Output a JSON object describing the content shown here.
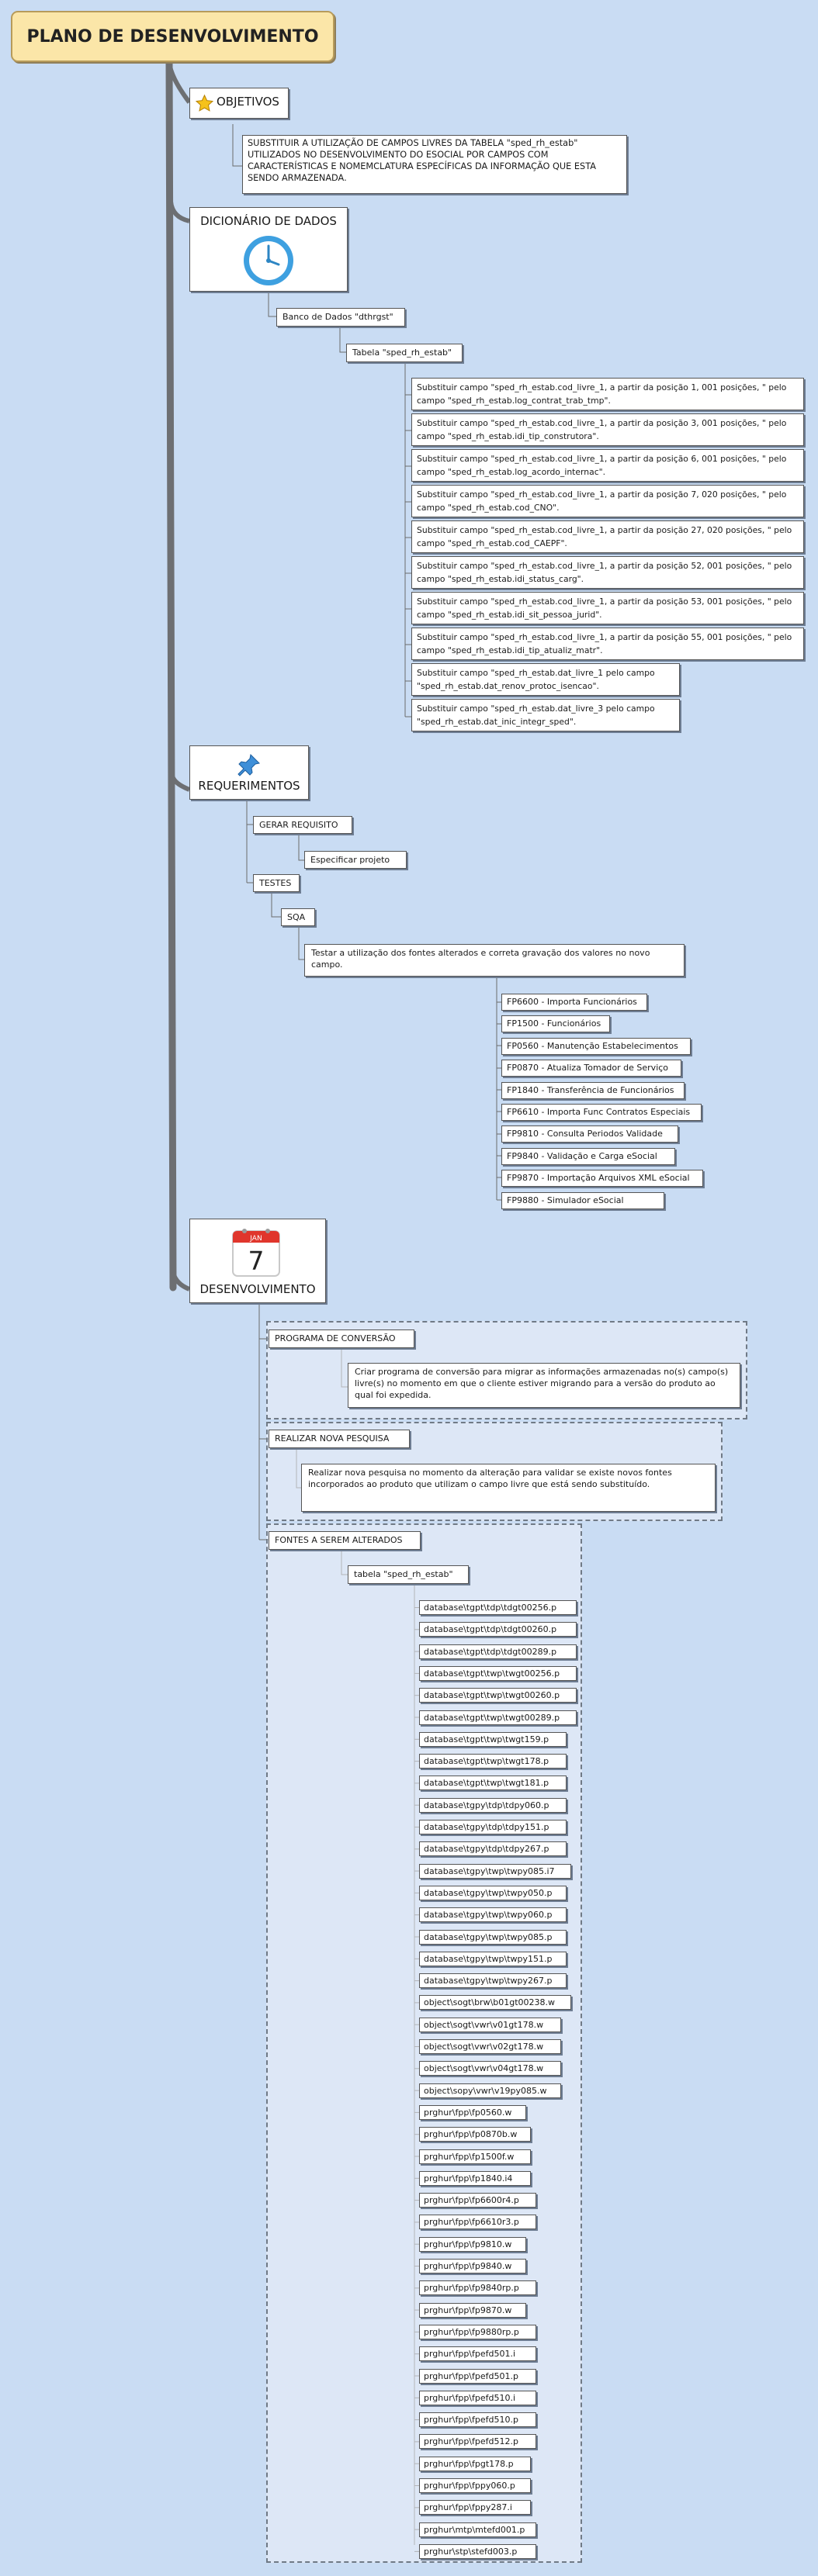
{
  "root": {
    "title": "PLANO DE DESENVOLVIMENTO"
  },
  "objetivos": {
    "label": "OBJETIVOS",
    "icon": "star-icon",
    "text": "SUBSTITUIR A UTILIZAÇÃO DE CAMPOS LIVRES DA TABELA \"sped_rh_estab\" UTILIZADOS NO DESENVOLVIMENTO DO ESOCIAL POR CAMPOS COM CARACTERÍSTICAS E NOMEMCLATURA ESPECÍFICAS DA INFORMAÇÃO QUE ESTA SENDO ARMAZENADA."
  },
  "dicionario": {
    "label": "DICIONÁRIO DE DADOS",
    "icon": "clock-icon",
    "banco": "Banco de Dados \"dthrgst\"",
    "tabela": "Tabela \"sped_rh_estab\"",
    "campos": [
      "Substituir campo \"sped_rh_estab.cod_livre_1, a partir da posição 1, 001 posições, \" pelo campo \"sped_rh_estab.log_contrat_trab_tmp\".",
      "Substituir campo \"sped_rh_estab.cod_livre_1, a partir da posição 3, 001 posições, \" pelo campo \"sped_rh_estab.idi_tip_construtora\".",
      "Substituir campo \"sped_rh_estab.cod_livre_1, a partir da posição 6, 001 posições, \" pelo campo \"sped_rh_estab.log_acordo_internac\".",
      "Substituir campo \"sped_rh_estab.cod_livre_1, a partir da posição 7, 020 posições, \" pelo campo \"sped_rh_estab.cod_CNO\".",
      "Substituir campo \"sped_rh_estab.cod_livre_1, a partir da posição 27, 020 posições, \" pelo campo \"sped_rh_estab.cod_CAEPF\".",
      "Substituir campo \"sped_rh_estab.cod_livre_1, a partir da posição 52, 001 posições, \" pelo campo \"sped_rh_estab.idi_status_carg\".",
      "Substituir campo \"sped_rh_estab.cod_livre_1, a partir da posição 53, 001 posições, \" pelo campo \"sped_rh_estab.idi_sit_pessoa_jurid\".",
      "Substituir campo \"sped_rh_estab.cod_livre_1, a partir da posição 55, 001 posições, \" pelo campo \"sped_rh_estab.idi_tip_atualiz_matr\".",
      "Substituir campo \"sped_rh_estab.dat_livre_1 pelo campo \"sped_rh_estab.dat_renov_protoc_isencao\".",
      "Substituir campo \"sped_rh_estab.dat_livre_3 pelo campo \"sped_rh_estab.dat_inic_integr_sped\"."
    ]
  },
  "requerimentos": {
    "label": "REQUERIMENTOS",
    "icon": "pushpin-icon",
    "gerar": "GERAR REQUISITO",
    "especificar": "Especificar projeto",
    "testes": "TESTES",
    "sqa": "SQA",
    "testar": "Testar a utilização dos fontes alterados e correta gravação dos valores no novo campo.",
    "programas": [
      "FP6600 - Importa Funcionários",
      "FP1500 - Funcionários",
      "FP0560 - Manutenção Estabelecimentos",
      "FP0870 - Atualiza Tomador de Serviço",
      "FP1840 - Transferência de Funcionários",
      "FP6610 - Importa Func Contratos Especiais",
      "FP9810 - Consulta Periodos Validade",
      "FP9840 - Validação e Carga eSocial",
      "FP9870 - Importação Arquivos XML eSocial",
      "FP9880 - Simulador eSocial"
    ]
  },
  "desenvolvimento": {
    "label": "DESENVOLVIMENTO",
    "icon": "calendar-icon",
    "calendar_month": "JAN",
    "calendar_day": "7",
    "programa": "PROGRAMA DE CONVERSÃO",
    "programa_text": "Criar programa de conversão para migrar as informações armazenadas no(s) campo(s) livre(s) no momento em que o cliente estiver migrando para a versão do produto ao qual foi expedida.",
    "pesquisa": "REALIZAR NOVA PESQUISA",
    "pesquisa_text": "Realizar nova pesquisa no momento da alteração para validar se existe novos fontes incorporados ao produto que utilizam o campo livre que está sendo substituído.",
    "fontes": "FONTES A SEREM ALTERADOS",
    "tabela": "tabela \"sped_rh_estab\"",
    "arquivos": [
      "database\\tgpt\\tdp\\tdgt00256.p",
      "database\\tgpt\\tdp\\tdgt00260.p",
      "database\\tgpt\\tdp\\tdgt00289.p",
      "database\\tgpt\\twp\\twgt00256.p",
      "database\\tgpt\\twp\\twgt00260.p",
      "database\\tgpt\\twp\\twgt00289.p",
      "database\\tgpt\\twp\\twgt159.p",
      "database\\tgpt\\twp\\twgt178.p",
      "database\\tgpt\\twp\\twgt181.p",
      "database\\tgpy\\tdp\\tdpy060.p",
      "database\\tgpy\\tdp\\tdpy151.p",
      "database\\tgpy\\tdp\\tdpy267.p",
      "database\\tgpy\\twp\\twpy085.i7",
      "database\\tgpy\\twp\\twpy050.p",
      "database\\tgpy\\twp\\twpy060.p",
      "database\\tgpy\\twp\\twpy085.p",
      "database\\tgpy\\twp\\twpy151.p",
      "database\\tgpy\\twp\\twpy267.p",
      "object\\sogt\\brw\\b01gt00238.w",
      "object\\sogt\\vwr\\v01gt178.w",
      "object\\sogt\\vwr\\v02gt178.w",
      "object\\sogt\\vwr\\v04gt178.w",
      "object\\sopy\\vwr\\v19py085.w",
      "prghur\\fpp\\fp0560.w",
      "prghur\\fpp\\fp0870b.w",
      "prghur\\fpp\\fp1500f.w",
      "prghur\\fpp\\fp1840.i4",
      "prghur\\fpp\\fp6600r4.p",
      "prghur\\fpp\\fp6610r3.p",
      "prghur\\fpp\\fp9810.w",
      "prghur\\fpp\\fp9840.w",
      "prghur\\fpp\\fp9840rp.p",
      "prghur\\fpp\\fp9870.w",
      "prghur\\fpp\\fp9880rp.p",
      "prghur\\fpp\\fpefd501.i",
      "prghur\\fpp\\fpefd501.p",
      "prghur\\fpp\\fpefd510.i",
      "prghur\\fpp\\fpefd510.p",
      "prghur\\fpp\\fpefd512.p",
      "prghur\\fpp\\fpgt178.p",
      "prghur\\fpp\\fppy060.p",
      "prghur\\fpp\\fppy287.i",
      "prghur\\mtp\\mtefd001.p",
      "prghur\\stp\\stefd003.p"
    ]
  }
}
